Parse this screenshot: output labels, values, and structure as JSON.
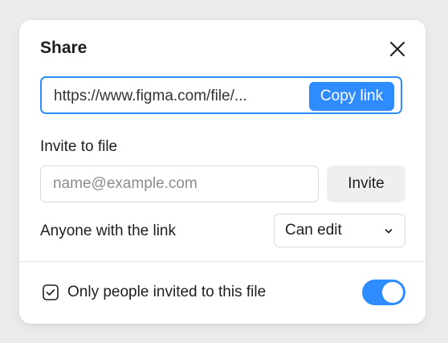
{
  "dialog": {
    "title": "Share",
    "close_icon": "close-icon"
  },
  "link": {
    "url": "https://www.figma.com/file/...",
    "copy_label": "Copy link"
  },
  "invite": {
    "section_label": "Invite to file",
    "email_placeholder": "name@example.com",
    "email_value": "",
    "invite_label": "Invite"
  },
  "permissions": {
    "label": "Anyone with the link",
    "selected": "Can edit",
    "chevron_icon": "chevron-down-icon"
  },
  "restriction": {
    "label": "Only people invited to this file",
    "checkbox_icon": "checkbox-checked-icon",
    "checked": true,
    "toggle_on": true
  },
  "colors": {
    "accent": "#2f8cff",
    "background": "#ebebeb",
    "surface": "#ffffff"
  }
}
